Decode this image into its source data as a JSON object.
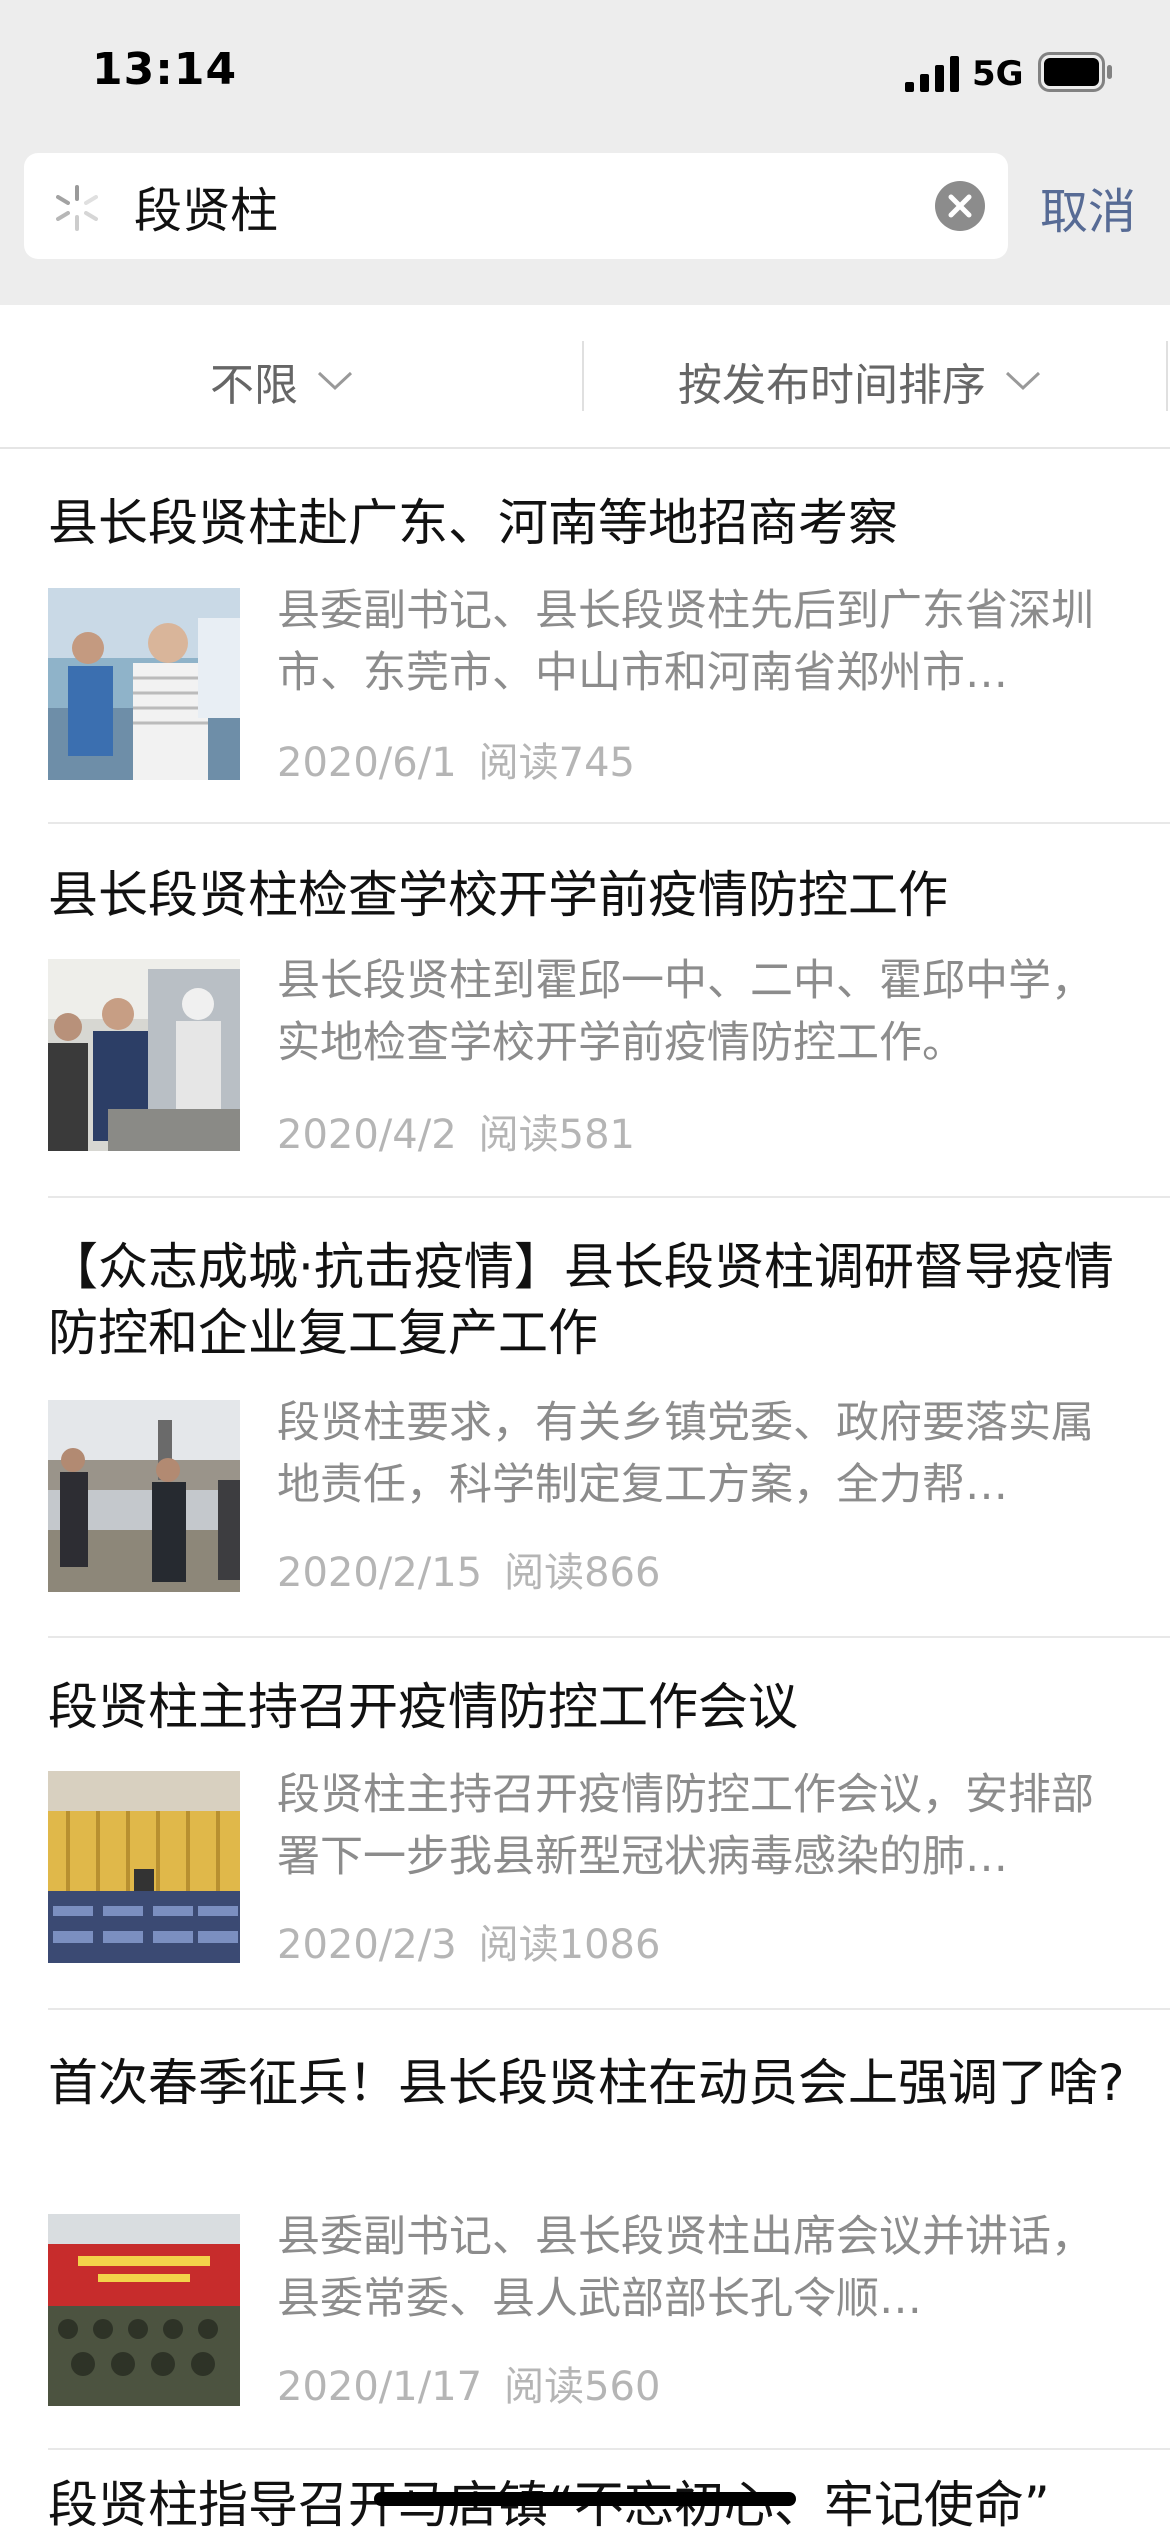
{
  "status_bar": {
    "time": "13:14",
    "network": "5G"
  },
  "search": {
    "query": "段贤柱",
    "cancel_label": "取消"
  },
  "filters": {
    "range_label": "不限",
    "sort_label": "按发布时间排序"
  },
  "results": [
    {
      "title": "县长段贤柱赴广东、河南等地招商考察",
      "snippet": "县委副书记、县长段贤柱先后到广东省深圳市、东莞市、中山市和河南省郑州市…",
      "date": "2020/6/1",
      "reads": "阅读745"
    },
    {
      "title": "县长段贤柱检查学校开学前疫情防控工作",
      "snippet": "县长段贤柱到霍邱一中、二中、霍邱中学，实地检查学校开学前疫情防控工作。",
      "date": "2020/4/2",
      "reads": "阅读581"
    },
    {
      "title": "【众志成城·抗击疫情】县长段贤柱调研督导疫情防控和企业复工复产工作",
      "snippet": "段贤柱要求，有关乡镇党委、政府要落实属地责任，科学制定复工方案，全力帮…",
      "date": "2020/2/15",
      "reads": "阅读866"
    },
    {
      "title": "段贤柱主持召开疫情防控工作会议",
      "snippet": "段贤柱主持召开疫情防控工作会议，安排部署下一步我县新型冠状病毒感染的肺…",
      "date": "2020/2/3",
      "reads": "阅读1086"
    },
    {
      "title": "首次春季征兵！县长段贤柱在动员会上强调了啥?",
      "snippet": "县委副书记、县长段贤柱出席会议并讲话，县委常委、县人武部部长孔令顺…",
      "date": "2020/1/17",
      "reads": "阅读560"
    }
  ],
  "partial_result": {
    "title": "段贤柱指导召开马店镇“不忘初心、牢记使命”"
  }
}
